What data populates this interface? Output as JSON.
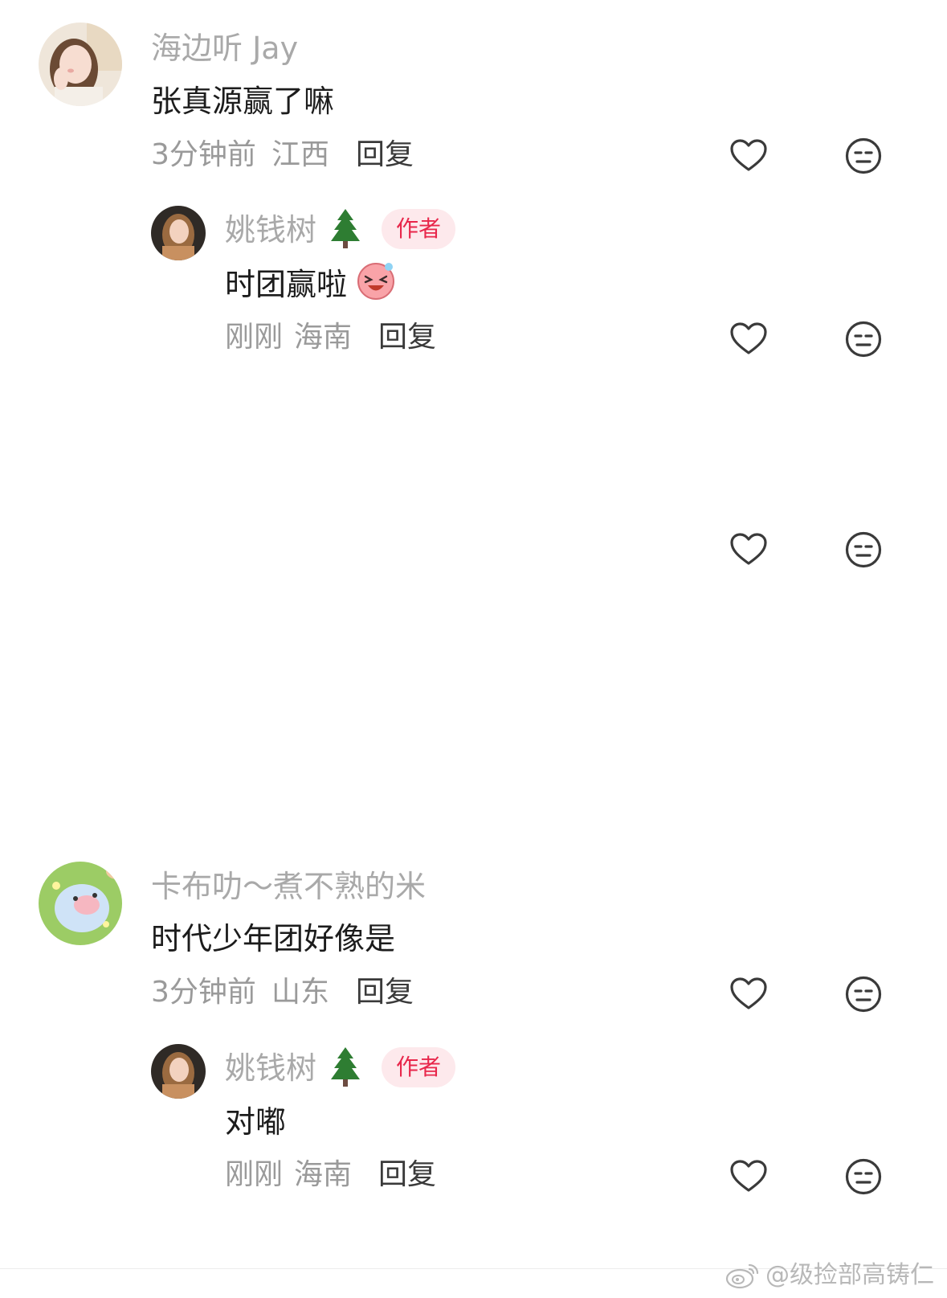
{
  "comments": [
    {
      "user": "海边听 Jay",
      "text": "张真源赢了嘛",
      "time": "3分钟前",
      "location": "江西",
      "reply_label": "回复",
      "reply": {
        "user": "姚钱树",
        "user_emoji": "evergreen-tree",
        "badge": "作者",
        "text": "时团赢啦",
        "text_emoji": "laughing-face-sticker",
        "time": "刚刚",
        "location": "海南",
        "reply_label": "回复"
      }
    },
    {
      "user": "卡布叻～煮不熟的米",
      "text": "时代少年团好像是",
      "time": "3分钟前",
      "location": "山东",
      "reply_label": "回复",
      "reply": {
        "user": "姚钱树",
        "user_emoji": "evergreen-tree",
        "badge": "作者",
        "text": "对嘟",
        "time": "刚刚",
        "location": "海南",
        "reply_label": "回复"
      }
    }
  ],
  "icons": {
    "like": "heart-outline-icon",
    "dislike": "neutral-face-icon"
  },
  "watermark": "@级捡部高铸仁",
  "watermark_icon": "weibo-logo",
  "colors": {
    "badge_text": "#e8274b",
    "badge_bg": "#fde9ec",
    "username": "#a9a9a9",
    "meta": "#9a9a9a"
  }
}
